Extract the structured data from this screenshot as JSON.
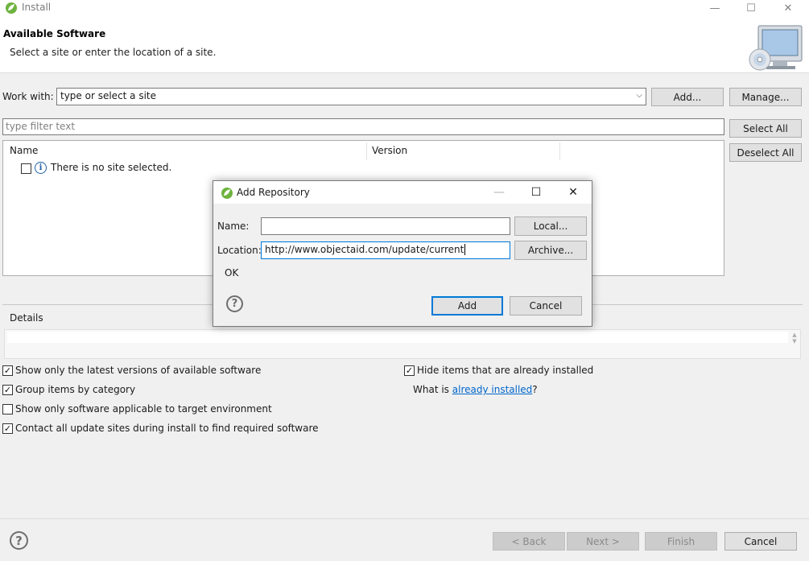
{
  "window": {
    "title": "Install",
    "minimize_glyph": "—",
    "maximize_glyph": "☐",
    "close_glyph": "✕"
  },
  "header": {
    "title": "Available Software",
    "subtitle": "Select a site or enter the location of a site."
  },
  "work_with": {
    "label": "Work with:",
    "value": "type or select a site",
    "arrow_glyph": "⌵",
    "add_label": "Add...",
    "manage_label": "Manage..."
  },
  "filter": {
    "placeholder": "type filter text",
    "select_all_label": "Select All",
    "deselect_all_label": "Deselect All"
  },
  "tree": {
    "columns": [
      "Name",
      "Version"
    ],
    "info_glyph": "i",
    "message": "There is no site selected."
  },
  "details": {
    "label": "Details"
  },
  "options": {
    "left": [
      {
        "label": "Show only the latest versions of available software",
        "checked": true
      },
      {
        "label": "Group items by category",
        "checked": true
      },
      {
        "label": "Show only software applicable to target environment",
        "checked": false
      },
      {
        "label": "Contact all update sites during install to find required software",
        "checked": true
      }
    ],
    "hide_installed": {
      "label": "Hide items that are already installed",
      "checked": true
    },
    "what_is_prefix": "What is ",
    "what_is_link": "already installed",
    "what_is_suffix": "?"
  },
  "footer": {
    "help_glyph": "?",
    "back_label": "< Back",
    "next_label": "Next >",
    "finish_label": "Finish",
    "cancel_label": "Cancel"
  },
  "dialog": {
    "title": "Add Repository",
    "minimize_glyph": "—",
    "maximize_glyph": "☐",
    "close_glyph": "✕",
    "name_label": "Name:",
    "name_value": "",
    "local_label": "Local...",
    "location_label": "Location:",
    "location_value": "http://www.objectaid.com/update/current",
    "archive_label": "Archive...",
    "status_text": "OK",
    "help_glyph": "?",
    "add_label": "Add",
    "cancel_label": "Cancel"
  },
  "colors": {
    "accent": "#0078d7",
    "link": "#0066cc",
    "app_icon_green": "#6db33f"
  },
  "icons": [
    "eclipse-spring-icon",
    "minimize-icon",
    "maximize-icon",
    "close-icon",
    "install-banner-icon",
    "dropdown-arrow-icon",
    "info-icon",
    "help-icon"
  ]
}
